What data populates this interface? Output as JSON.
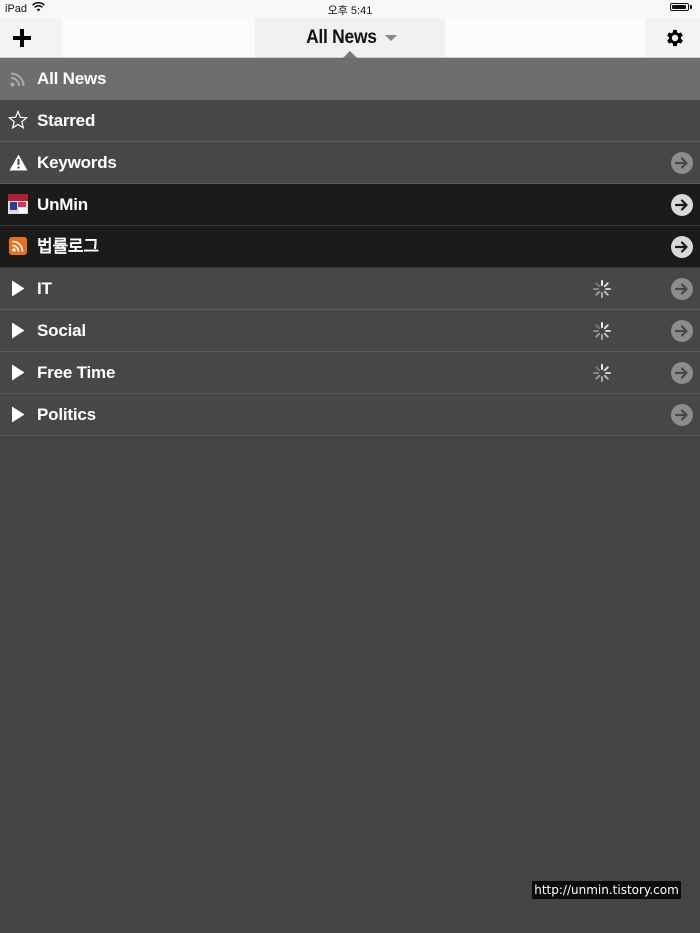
{
  "status_bar": {
    "device": "iPad",
    "time": "오후 5:41",
    "battery_level": 0.9
  },
  "nav": {
    "title": "All News",
    "add_icon": "plus-icon",
    "settings_icon": "gear-icon",
    "caret_icon": "chevron-down-icon"
  },
  "feeds": [
    {
      "label": "All News",
      "icon": "rss-icon",
      "style": "selected",
      "arrow": false,
      "loading": false
    },
    {
      "label": "Starred",
      "icon": "star-outline-icon",
      "style": "normal",
      "arrow": false,
      "loading": false
    },
    {
      "label": "Keywords",
      "icon": "warning-icon",
      "style": "normal",
      "arrow": true,
      "loading": false
    },
    {
      "label": "UnMin",
      "icon": "site-favicon-icon",
      "style": "dark",
      "arrow": true,
      "loading": false
    },
    {
      "label": "법률로그",
      "icon": "rss-orange-icon",
      "style": "dark",
      "arrow": true,
      "loading": false
    },
    {
      "label": "IT",
      "icon": "folder-expand-icon",
      "style": "normal",
      "arrow": true,
      "loading": true
    },
    {
      "label": "Social",
      "icon": "folder-expand-icon",
      "style": "normal",
      "arrow": true,
      "loading": true
    },
    {
      "label": "Free Time",
      "icon": "folder-expand-icon",
      "style": "normal",
      "arrow": true,
      "loading": true
    },
    {
      "label": "Politics",
      "icon": "folder-expand-icon",
      "style": "normal",
      "arrow": true,
      "loading": false
    }
  ],
  "watermark": "http://unmin.tistory.com",
  "colors": {
    "background": "#444444",
    "selected_row": "#6e6e6e",
    "dark_row": "#1b1b1b",
    "rss_orange": "#e8731f"
  }
}
